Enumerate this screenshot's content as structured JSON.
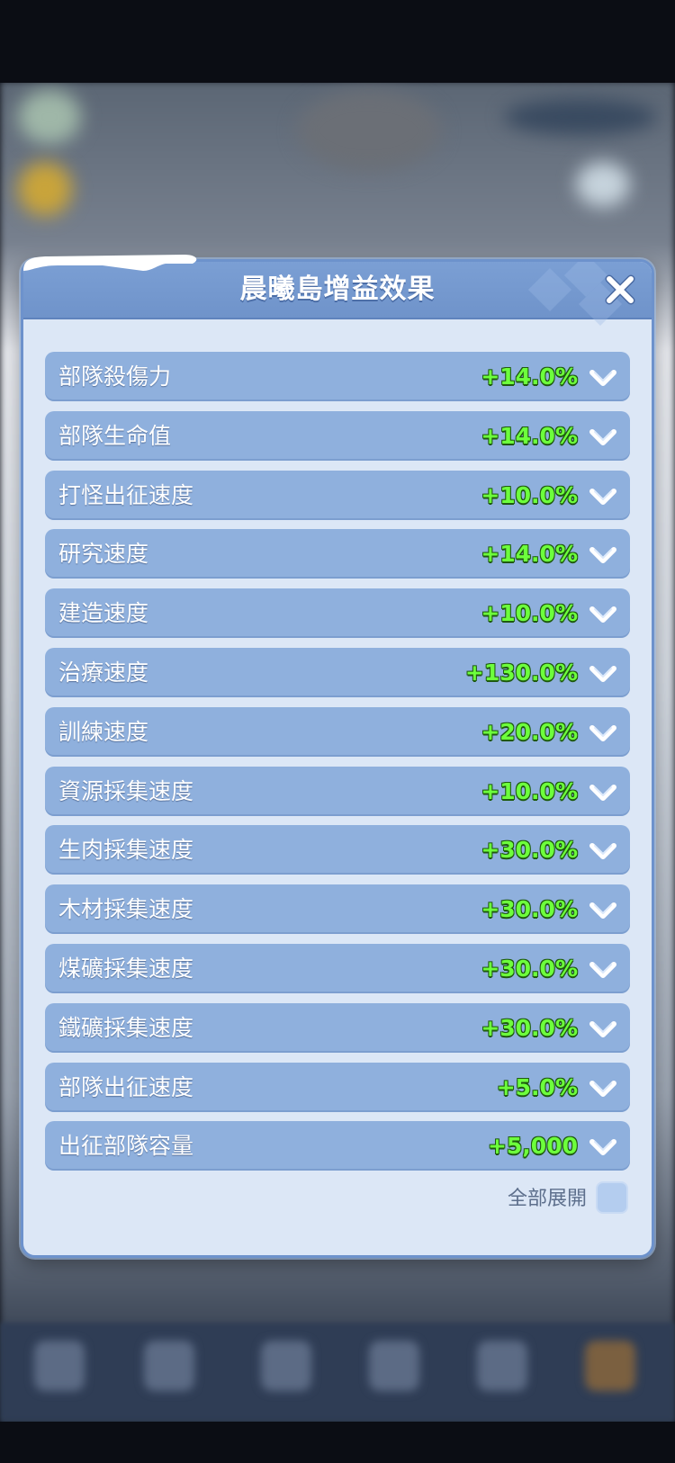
{
  "modal": {
    "title": "晨曦島增益效果",
    "close_icon": "close-icon"
  },
  "buffs": [
    {
      "label": "部隊殺傷力",
      "value": "+14.0%"
    },
    {
      "label": "部隊生命值",
      "value": "+14.0%"
    },
    {
      "label": "打怪出征速度",
      "value": "+10.0%"
    },
    {
      "label": "研究速度",
      "value": "+14.0%"
    },
    {
      "label": "建造速度",
      "value": "+10.0%"
    },
    {
      "label": "治療速度",
      "value": "+130.0%"
    },
    {
      "label": "訓練速度",
      "value": "+20.0%"
    },
    {
      "label": "資源採集速度",
      "value": "+10.0%"
    },
    {
      "label": "生肉採集速度",
      "value": "+30.0%"
    },
    {
      "label": "木材採集速度",
      "value": "+30.0%"
    },
    {
      "label": "煤礦採集速度",
      "value": "+30.0%"
    },
    {
      "label": "鐵礦採集速度",
      "value": "+30.0%"
    },
    {
      "label": "部隊出征速度",
      "value": "+5.0%"
    },
    {
      "label": "出征部隊容量",
      "value": "+5,000"
    }
  ],
  "footer": {
    "expand_all_label": "全部展開",
    "expand_all_checked": false
  },
  "colors": {
    "row_background": "#8fb0dd",
    "value_green": "#6dff3c",
    "header_blue": "#7b9fd4",
    "panel_background": "#dce7f6"
  }
}
